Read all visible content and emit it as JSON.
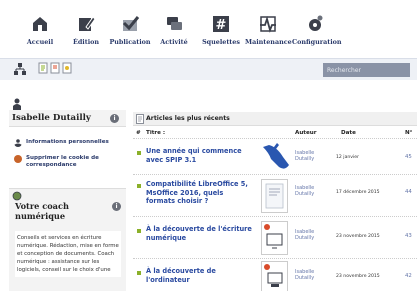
{
  "nav": {
    "items": [
      {
        "label": "Accueil",
        "icon": "home-icon"
      },
      {
        "label": "Édition",
        "icon": "pencil-icon"
      },
      {
        "label": "Publication",
        "icon": "checkmark-icon"
      },
      {
        "label": "Activité",
        "icon": "speech-bubbles-icon"
      },
      {
        "label": "Squelettes",
        "icon": "hash-icon"
      },
      {
        "label": "Maintenance",
        "icon": "pulse-icon"
      },
      {
        "label": "Configuration",
        "icon": "gear-icon"
      }
    ]
  },
  "toolbar": {
    "search_placeholder": "Rechercher"
  },
  "user": {
    "name": "Isabelle Dutailly",
    "links": [
      {
        "label": "Informations personnelles"
      },
      {
        "label": "Supprimer le cookie de correspondance"
      }
    ]
  },
  "coach": {
    "title": "Votre coach numérique",
    "text": "Conseils et services en écriture numérique. Rédaction, mise en forme et conception de documents. Coach numérique : assistance sur les logiciels, conseil sur le choix d'une"
  },
  "articles": {
    "heading": "Articles les plus récents",
    "columns": {
      "num": "#",
      "title": "Titre :",
      "author": "Auteur",
      "date": "Date",
      "id": "N°"
    },
    "rows": [
      {
        "title": "Une année qui commence avec SPIP 3.1",
        "author": "Isabelle Dutailly",
        "date": "12 janvier",
        "id": "45"
      },
      {
        "title": "Compatibilité LibreOffice 5, MsOffice 2016, quels formats choisir ?",
        "author": "Isabelle Dutailly",
        "date": "17 décembre 2015",
        "id": "44"
      },
      {
        "title": "À la découverte de l'écriture numérique",
        "author": "Isabelle Dutailly",
        "date": "23 novembre 2015",
        "id": "43"
      },
      {
        "title": "À la découverte de l'ordinateur",
        "author": "Isabelle Dutailly",
        "date": "23 novembre 2015",
        "id": "42"
      }
    ]
  },
  "colors": {
    "nav_label": "#2a3a6a",
    "link": "#2a4aa0",
    "bullet": "#8bb02a",
    "toolbar_bg": "#eef1f6"
  }
}
